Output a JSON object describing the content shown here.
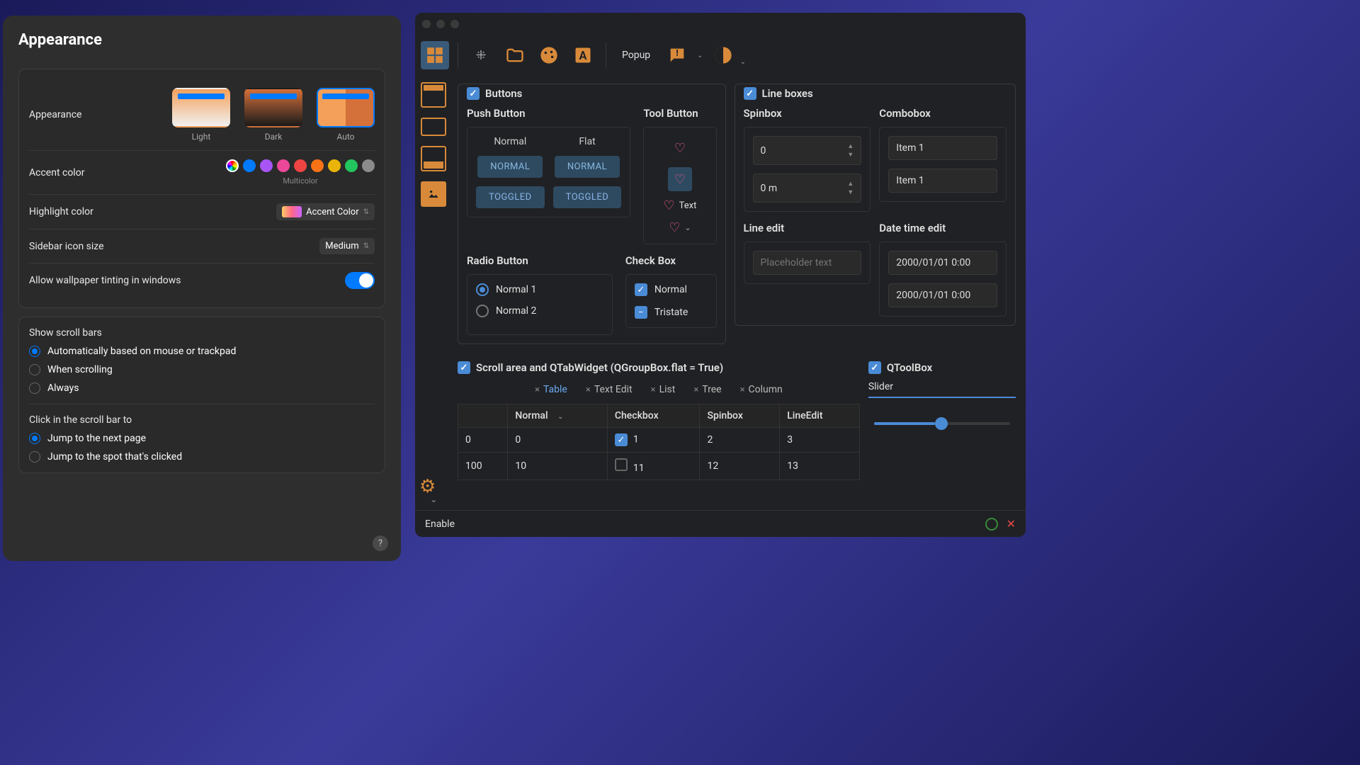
{
  "left": {
    "title": "Appearance",
    "appearance": {
      "label": "Appearance",
      "options": [
        "Light",
        "Dark",
        "Auto"
      ],
      "selected": "Auto"
    },
    "accent": {
      "label": "Accent color",
      "multicolor_label": "Multicolor",
      "colors": [
        "#007aff",
        "#a855f7",
        "#ec4899",
        "#ef4444",
        "#f97316",
        "#eab308",
        "#22c55e",
        "#8b8b8b"
      ]
    },
    "highlight": {
      "label": "Highlight color",
      "value": "Accent Color"
    },
    "sidebar_icon": {
      "label": "Sidebar icon size",
      "value": "Medium"
    },
    "wallpaper_tint": {
      "label": "Allow wallpaper tinting in windows",
      "value": true
    },
    "scrollbars": {
      "title": "Show scroll bars",
      "options": [
        "Automatically based on mouse or trackpad",
        "When scrolling",
        "Always"
      ],
      "selected": 0
    },
    "click_scroll": {
      "title": "Click in the scroll bar to",
      "options": [
        "Jump to the next page",
        "Jump to the spot that's clicked"
      ],
      "selected": 0
    },
    "help": "?"
  },
  "right": {
    "toolbar": {
      "popup": "Popup"
    },
    "buttons": {
      "title": "Buttons",
      "push": {
        "title": "Push Button",
        "normal": "Normal",
        "flat": "Flat",
        "normal_btn": "NORMAL",
        "toggled_btn": "TOGGLED"
      },
      "tool": {
        "title": "Tool Button",
        "text": "Text"
      },
      "radio": {
        "title": "Radio Button",
        "opt1": "Normal 1",
        "opt2": "Normal 2"
      },
      "checkbox": {
        "title": "Check Box",
        "normal": "Normal",
        "tristate": "Tristate"
      }
    },
    "lineboxes": {
      "title": "Line boxes",
      "spinbox": {
        "title": "Spinbox",
        "val1": "0",
        "val2": "0 m"
      },
      "combobox": {
        "title": "Combobox",
        "val1": "Item 1",
        "val2": "Item 1"
      },
      "lineedit": {
        "title": "Line edit",
        "placeholder": "Placeholder text"
      },
      "datetime": {
        "title": "Date time edit",
        "val1": "2000/01/01 0:00",
        "val2": "2000/01/01 0:00"
      }
    },
    "scroll": {
      "title": "Scroll area and QTabWidget (QGroupBox.flat = True)",
      "tabs": [
        "Table",
        "Text Edit",
        "List",
        "Tree",
        "Column"
      ],
      "active_tab": 0,
      "table": {
        "headers": [
          "",
          "Normal",
          "Checkbox",
          "Spinbox",
          "LineEdit"
        ],
        "rows": [
          {
            "idx": "0",
            "normal": "0",
            "checkbox": "1",
            "checked": true,
            "spinbox": "2",
            "lineedit": "3"
          },
          {
            "idx": "100",
            "normal": "10",
            "checkbox": "11",
            "checked": false,
            "spinbox": "12",
            "lineedit": "13"
          }
        ]
      }
    },
    "toolbox": {
      "title": "QToolBox",
      "slider_label": "Slider",
      "slider_value": 45
    },
    "bottom": {
      "enable": "Enable"
    }
  }
}
